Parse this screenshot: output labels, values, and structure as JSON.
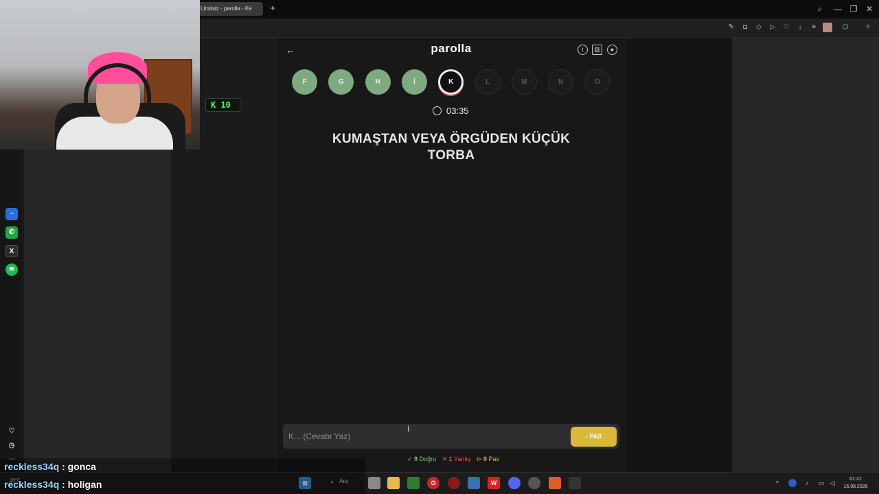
{
  "browser": {
    "tab_title": "Limitsiz - parolla - Ke",
    "new_tab": "+",
    "minimize": "—",
    "restore": "❐",
    "close": "✕"
  },
  "overlay": {
    "kick_badge": "K 10"
  },
  "app": {
    "title": "parolla",
    "letters": [
      {
        "char": "F",
        "state": "done"
      },
      {
        "char": "G",
        "state": "done"
      },
      {
        "char": "H",
        "state": "done"
      },
      {
        "char": "İ",
        "state": "done"
      },
      {
        "char": "K",
        "state": "active"
      },
      {
        "char": "L",
        "state": "pending"
      },
      {
        "char": "M",
        "state": "pending"
      },
      {
        "char": "N",
        "state": "pending"
      },
      {
        "char": "O",
        "state": "pending"
      }
    ],
    "timer": "03:35",
    "question": "KUMAŞTAN VEYA ÖRGÜDEN KÜÇÜK TORBA",
    "answer_placeholder": "K... (Cevabı Yaz)",
    "pas_label": "PAS",
    "stats": {
      "correct_count": "9",
      "correct_label": "Doğru",
      "wrong_count": "1",
      "wrong_label": "Yanlış",
      "pass_count": "0",
      "pass_label": "Pas"
    },
    "colors": {
      "done": "#7fa980",
      "active_underline": "#e3505a",
      "pas_button": "#d9b83a",
      "correct": "#7fbf80",
      "wrong": "#e05555",
      "pass": "#d9b83a"
    }
  },
  "chat": [
    {
      "user": "reckless34q",
      "message": ": gonca"
    },
    {
      "user": "reckless34q",
      "message": ": holigan"
    }
  ],
  "taskbar": {
    "search_label": "Ara",
    "weather": "18°C",
    "time": "01:21",
    "date": "16.08.2026"
  }
}
